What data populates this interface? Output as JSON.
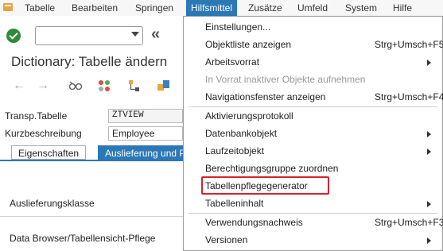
{
  "menubar": {
    "items": [
      "Tabelle",
      "Bearbeiten",
      "Springen",
      "Hilfsmittel",
      "Zusätze",
      "Umfeld",
      "System",
      "Hilfe"
    ],
    "active": "Hilfsmittel"
  },
  "toolbar": {
    "command_value": ""
  },
  "title": "Dictionary: Tabelle ändern",
  "form": {
    "table_label": "Transp.Tabelle",
    "table_value": "ZTVIEW",
    "desc_label": "Kurzbeschreibung",
    "desc_value": "Employee"
  },
  "tabs": {
    "tab1": "Eigenschaften",
    "tab2": "Auslieferung und Pflege"
  },
  "sections": {
    "delivery_class": "Auslieferungsklasse",
    "data_browser": "Data Browser/Tabellensicht-Pflege"
  },
  "dropdown": {
    "items": [
      {
        "label": "Einstellungen...",
        "shortcut": ""
      },
      {
        "label": "Objektliste anzeigen",
        "shortcut": "Strg+Umsch+F5"
      },
      {
        "label": "Arbeitsvorrat",
        "shortcut": ""
      },
      {
        "label": "In Vorrat inaktiver Objekte aufnehmen",
        "shortcut": ""
      },
      {
        "label": "Navigationsfenster anzeigen",
        "shortcut": "Strg+Umsch+F4"
      },
      {
        "label": "Aktivierungsprotokoll",
        "shortcut": ""
      },
      {
        "label": "Datenbankobjekt",
        "shortcut": ""
      },
      {
        "label": "Laufzeitobjekt",
        "shortcut": ""
      },
      {
        "label": "Berechtigungsgruppe zuordnen",
        "shortcut": ""
      },
      {
        "label": "Tabellenpflegegenerator",
        "shortcut": ""
      },
      {
        "label": "Tabelleninhalt",
        "shortcut": ""
      },
      {
        "label": "Verwendungsnachweis",
        "shortcut": "Strg+Umsch+F3"
      },
      {
        "label": "Versionen",
        "shortcut": ""
      }
    ]
  },
  "colors": {
    "accent": "#2b78b7",
    "highlight": "#d9202c"
  }
}
